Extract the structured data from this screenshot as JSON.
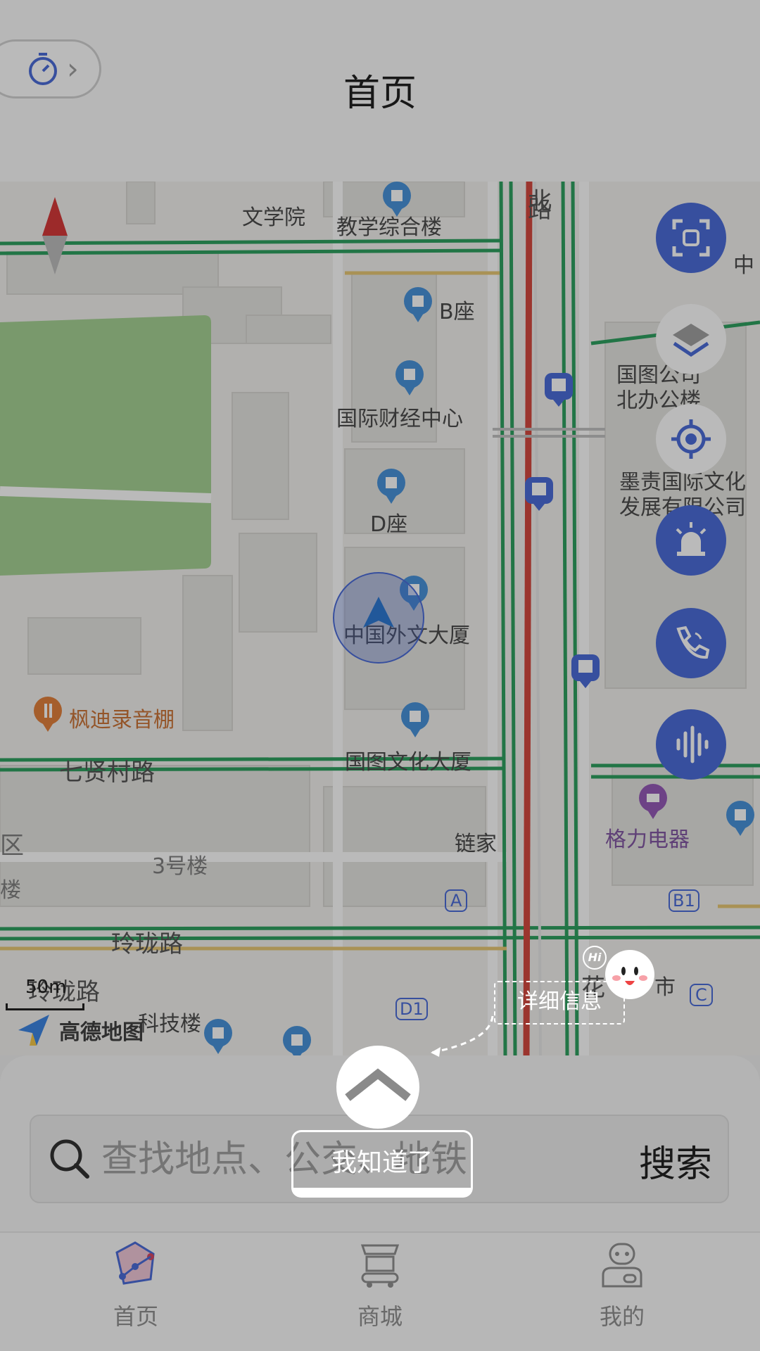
{
  "header": {
    "title": "首页",
    "pedometer_icon": "pedometer-icon",
    "chevron": "›"
  },
  "map": {
    "labels": {
      "wenxueyuan": "文学院",
      "jiaoxue": "教学综合楼",
      "bzuo": "B座",
      "guoji": "国际财经中心",
      "dzuo": "D座",
      "waiwen": "中国外文大厦",
      "fengdi": "枫迪录音棚",
      "qixian": "七贤村路",
      "guotu": "国图文化大厦",
      "lianjia": "链家",
      "sanhao": "3号楼",
      "linglong": "玲珑路",
      "linglong2": "玲珑路",
      "geli": "格力电器",
      "guotu_north_1": "国图公司",
      "guotu_north_2": "北办公楼",
      "mozhe_1": "墨责国际文化",
      "mozhe_2": "发展有限公司",
      "zhong": "中",
      "lu": "路",
      "bei": "北",
      "qu": "区",
      "lou": "楼",
      "kejilou": "科技楼",
      "hua": "花",
      "shi": "市",
      "exit_a": "A",
      "exit_b1": "B1",
      "exit_c": "C",
      "exit_d1": "D1"
    },
    "scale": "50m",
    "brand": "高德地图",
    "side_buttons": [
      "scan-icon",
      "layers-icon",
      "locate-icon",
      "alarm-icon",
      "phone-icon",
      "voice-icon"
    ]
  },
  "search": {
    "placeholder": "查找地点、公交、地铁",
    "button": "搜索"
  },
  "tabs": [
    {
      "label": "首页",
      "icon": "home-map-icon"
    },
    {
      "label": "商城",
      "icon": "shop-icon"
    },
    {
      "label": "我的",
      "icon": "profile-icon"
    }
  ],
  "guide": {
    "got_it": "我知道了",
    "detail_tip": "详细信息",
    "hi": "Hi"
  },
  "colors": {
    "accent": "#3f62d6",
    "road_green": "#1f9a55",
    "road_red": "#d23b32",
    "park": "#9fcf8d"
  }
}
